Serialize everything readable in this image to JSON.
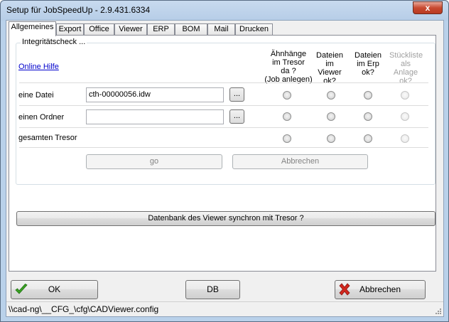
{
  "window": {
    "title": "Setup für JobSpeedUp - 2.9.431.6334",
    "close_label": "x"
  },
  "tabs": [
    "Allgemeines",
    "Export",
    "Office",
    "Viewer",
    "ERP",
    "BOM",
    "Mail",
    "Drucken"
  ],
  "active_tab": "Allgemeines",
  "integrity": {
    "group_label": "Integritätscheck ...",
    "online_help": "Online Hilfe",
    "columns": [
      {
        "label": "Ähnhänge\nim Tresor\nda ?\n(Job anlegen)",
        "enabled": true
      },
      {
        "label": "Dateien\nim\nViewer\nok?",
        "enabled": true
      },
      {
        "label": "Dateien\nim Erp\nok?",
        "enabled": true
      },
      {
        "label": "Stückliste\nals\nAnlage\nok?",
        "enabled": false
      }
    ],
    "rows": [
      {
        "label": "eine Datei",
        "value": "cth-00000056.idw",
        "has_input": true
      },
      {
        "label": "einen Ordner",
        "value": "",
        "has_input": true
      },
      {
        "label": "gesamten Tresor",
        "value": "",
        "has_input": false
      }
    ],
    "browse_label": "...",
    "go_label": "go",
    "cancel_label": "Abbrechen"
  },
  "sync_button_label": "Datenbank des Viewer synchron mit Tresor ?",
  "footer": {
    "ok_label": "OK",
    "db_label": "DB",
    "cancel_label": "Abbrechen",
    "ok_icon": "green-check-icon",
    "cancel_icon": "red-x-icon"
  },
  "status_path": "\\\\cad-ng\\__CFG_\\cfg\\CADViewer.config",
  "colors": {
    "link": "#0000cc",
    "check_green": "#3aa323",
    "cancel_red": "#d2281e"
  }
}
